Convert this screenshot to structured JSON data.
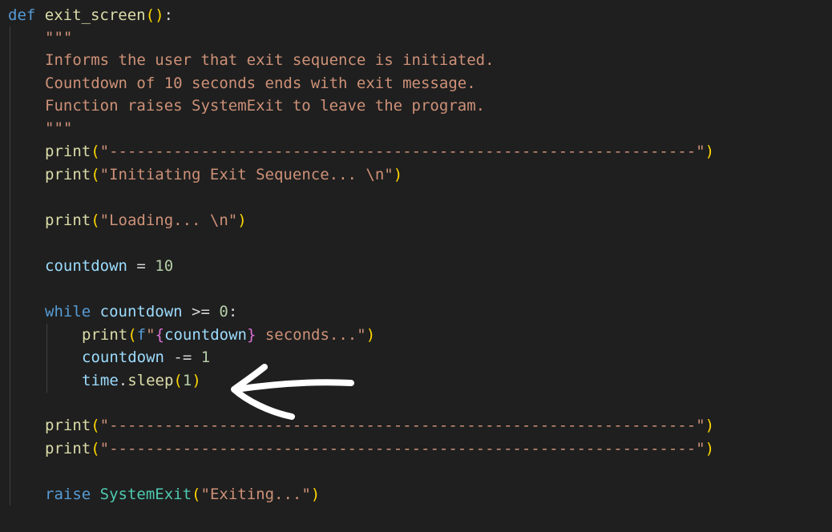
{
  "code": {
    "l1": {
      "kw": "def",
      "fn": "exit_screen",
      "open": "(",
      "close": ")",
      "colon": ":"
    },
    "l2": {
      "doc": "\"\"\""
    },
    "l3": {
      "doc": "Informs the user that exit sequence is initiated."
    },
    "l4": {
      "doc": "Countdown of 10 seconds ends with exit message."
    },
    "l5": {
      "doc": "Function raises SystemExit to leave the program."
    },
    "l6": {
      "doc": "\"\"\""
    },
    "l7": {
      "fn": "print",
      "open": "(",
      "str": "\"----------------------------------------------------------------\"",
      "close": ")"
    },
    "l8": {
      "fn": "print",
      "open": "(",
      "str": "\"Initiating Exit Sequence... \\n\"",
      "close": ")"
    },
    "l9": {
      "fn": "print",
      "open": "(",
      "str": "\"Loading... \\n\"",
      "close": ")"
    },
    "l10": {
      "var": "countdown",
      "op": " = ",
      "num": "10"
    },
    "l11": {
      "kw": "while",
      "var": "countdown",
      "op": " >= ",
      "num": "0",
      "colon": ":"
    },
    "l12": {
      "fn": "print",
      "open": "(",
      "fprefix": "f",
      "str_open": "\"",
      "brace_open": "{",
      "var": "countdown",
      "brace_close": "}",
      "str_rest": " seconds...\"",
      "close": ")"
    },
    "l13": {
      "var": "countdown",
      "op": " -= ",
      "num": "1"
    },
    "l14": {
      "var": "time",
      "dot": ".",
      "fn": "sleep",
      "open": "(",
      "num": "1",
      "close": ")"
    },
    "l15": {
      "fn": "print",
      "open": "(",
      "str": "\"----------------------------------------------------------------\"",
      "close": ")"
    },
    "l16": {
      "fn": "print",
      "open": "(",
      "str": "\"----------------------------------------------------------------\"",
      "close": ")"
    },
    "l17": {
      "kw": "raise",
      "cls": "SystemExit",
      "open": "(",
      "str": "\"Exiting...\"",
      "close": ")"
    }
  },
  "annotation": {
    "icon": "hand-drawn-arrow-icon",
    "color": "#ffffff"
  },
  "colors": {
    "background": "#1f1f1f",
    "keyword": "#569cd6",
    "function": "#dcdcaa",
    "variable": "#9cdcfe",
    "string": "#ce9178",
    "number": "#b5cea8",
    "bracket_level1": "#ffd700",
    "bracket_level2": "#da70d6"
  }
}
